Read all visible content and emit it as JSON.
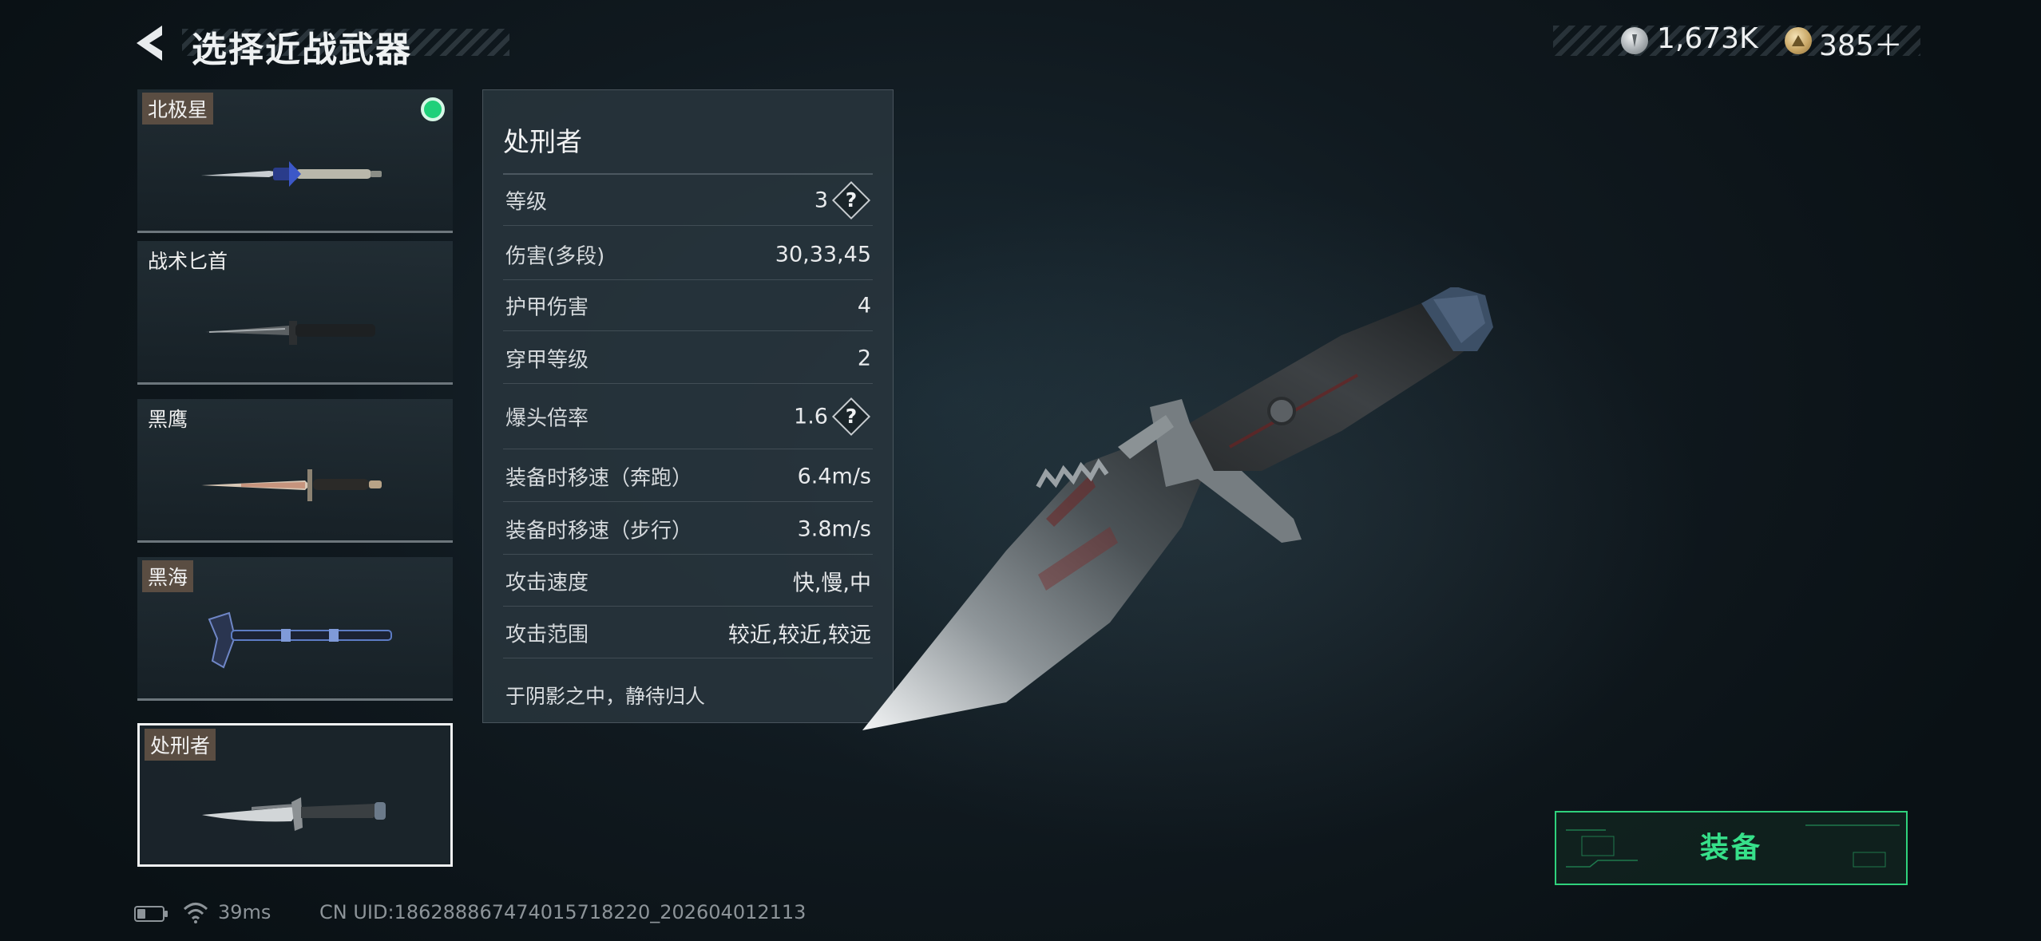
{
  "header": {
    "title": "选择近战武器"
  },
  "currency": {
    "silver": "1,673K",
    "gold": "385＋"
  },
  "weapons": [
    {
      "name": "北极星",
      "tag": true,
      "equipped": true
    },
    {
      "name": "战术匕首",
      "tag": false,
      "equipped": false
    },
    {
      "name": "黑鹰",
      "tag": false,
      "equipped": false
    },
    {
      "name": "黑海",
      "tag": true,
      "equipped": false
    },
    {
      "name": "处刑者",
      "tag": true,
      "equipped": false,
      "selected": true
    }
  ],
  "panel": {
    "title": "处刑者",
    "stats": [
      {
        "label": "等级",
        "value": "3",
        "help": true
      },
      {
        "label": "伤害(多段)",
        "value": "30,33,45",
        "help": false
      },
      {
        "label": "护甲伤害",
        "value": "4",
        "help": false
      },
      {
        "label": "穿甲等级",
        "value": "2",
        "help": false
      },
      {
        "label": "爆头倍率",
        "value": "1.6",
        "help": true
      },
      {
        "label": "装备时移速（奔跑）",
        "value": "6.4m/s",
        "help": false
      },
      {
        "label": "装备时移速（步行）",
        "value": "3.8m/s",
        "help": false
      },
      {
        "label": "攻击速度",
        "value": "快,慢,中",
        "help": false
      },
      {
        "label": "攻击范围",
        "value": "较近,较近,较远",
        "help": false
      }
    ],
    "flavor": "于阴影之中，静待归人"
  },
  "equip": {
    "label": "装备"
  },
  "footer": {
    "ping": "39ms",
    "uid": "CN UID:1862888674740157182​20_202604012113"
  },
  "colors": {
    "accent_green": "#37e08a",
    "equipped_dot": "#1fd07a"
  }
}
